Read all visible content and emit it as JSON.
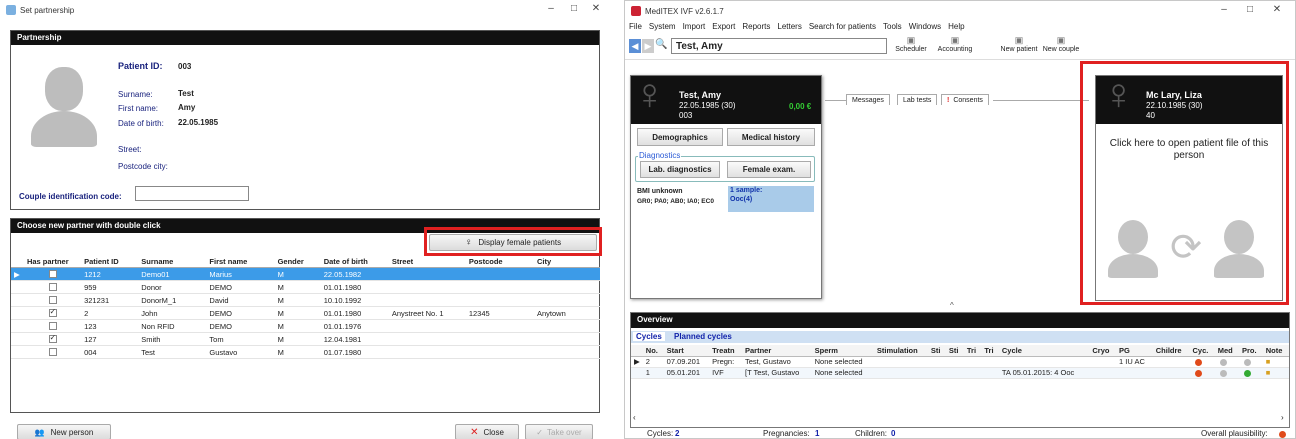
{
  "left": {
    "title": "Set partnership",
    "partnership_header": "Partnership",
    "patient_id_label": "Patient ID:",
    "patient_id": "003",
    "surname_label": "Surname:",
    "surname": "Test",
    "firstname_label": "First name:",
    "firstname": "Amy",
    "dob_label": "Date of birth:",
    "dob": "22.05.1985",
    "street_label": "Street:",
    "postcode_label": "Postcode city:",
    "couple_label": "Couple identification code:",
    "couple_value": "",
    "choose_header": "Choose new partner with double click",
    "display_female_button": "Display female patients",
    "columns": [
      "Has partner",
      "Patient ID",
      "Surname",
      "First name",
      "Gender",
      "Date of birth",
      "Street",
      "Postcode",
      "City"
    ],
    "rows": [
      {
        "has_partner": false,
        "id": "1212",
        "surname": "Demo01",
        "first": "Marius",
        "gender": "M",
        "dob": "22.05.1982",
        "street": "",
        "postcode": "",
        "city": "",
        "selected": true
      },
      {
        "has_partner": false,
        "id": "959",
        "surname": "Donor",
        "first": "DEMO",
        "gender": "M",
        "dob": "01.01.1980",
        "street": "",
        "postcode": "",
        "city": ""
      },
      {
        "has_partner": false,
        "id": "321231",
        "surname": "DonorM_1",
        "first": "David",
        "gender": "M",
        "dob": "10.10.1992",
        "street": "",
        "postcode": "",
        "city": ""
      },
      {
        "has_partner": true,
        "id": "2",
        "surname": "John",
        "first": "DEMO",
        "gender": "M",
        "dob": "01.01.1980",
        "street": "Anystreet No. 1",
        "postcode": "12345",
        "city": "Anytown"
      },
      {
        "has_partner": false,
        "id": "123",
        "surname": "Non RFID",
        "first": "DEMO",
        "gender": "M",
        "dob": "01.01.1976",
        "street": "",
        "postcode": "",
        "city": ""
      },
      {
        "has_partner": true,
        "id": "127",
        "surname": "Smith",
        "first": "Tom",
        "gender": "M",
        "dob": "12.04.1981",
        "street": "",
        "postcode": "",
        "city": ""
      },
      {
        "has_partner": false,
        "id": "004",
        "surname": "Test",
        "first": "Gustavo",
        "gender": "M",
        "dob": "01.07.1980",
        "street": "",
        "postcode": "",
        "city": ""
      }
    ],
    "new_person_button": "New person",
    "close_button": "Close",
    "take_over_button": "Take over"
  },
  "right": {
    "title": "MedITEX IVF v2.6.1.7",
    "menu": [
      "File",
      "System",
      "Import",
      "Export",
      "Reports",
      "Letters",
      "Search for patients",
      "Tools",
      "Windows",
      "Help"
    ],
    "patient_name": "Test, Amy",
    "toolbar": [
      "Scheduler",
      "Accounting",
      "New patient",
      "New couple"
    ],
    "card": {
      "name": "Test, Amy",
      "dob": "22.05.1985 (30)",
      "id": "003",
      "balance": "0,00 €"
    },
    "demographics": "Demographics",
    "medical_history": "Medical history",
    "diagnostics_label": "Diagnostics",
    "lab_diag": "Lab. diagnostics",
    "female_exam": "Female exam.",
    "bmi": "BMI unknown",
    "gr": "GR0; PA0; AB0; IA0; EC0",
    "sample": "1 sample:",
    "sample_detail": "Ooc(4)",
    "tabs": [
      "Messages",
      "Lab tests",
      "Consents"
    ],
    "partner": {
      "name": "Mc Lary, Liza",
      "dob": "22.10.1985 (30)",
      "id": "40",
      "open_text": "Click here to open patient file of this person"
    },
    "overview_header": "Overview",
    "cycle_tabs": [
      "Cycles",
      "Planned cycles"
    ],
    "cycle_columns": [
      "No.",
      "Start",
      "Treatn",
      "Partner",
      "Sperm",
      "Stimulation",
      "Sti",
      "Sti",
      "Tri",
      "Tri",
      "Cycle",
      "Cryo",
      "PG",
      "Childre",
      "Cyc.",
      "Med",
      "Pro.",
      "Note"
    ],
    "cycles": [
      {
        "no": "2",
        "start": "07.09.201",
        "treat": "Pregn:",
        "partner": "Test, Gustavo",
        "sperm": "None selected",
        "cycle": "",
        "pg": "1 IU AC"
      },
      {
        "no": "1",
        "start": "05.01.201",
        "treat": "IVF",
        "partner": "[T Test, Gustavo",
        "sperm": "None selected",
        "cycle": "TA 05.01.2015: 4 Ooc",
        "pg": ""
      }
    ],
    "footer_cycles_label": "Cycles:",
    "footer_cycles": "2",
    "footer_preg_label": "Pregnancies:",
    "footer_preg": "1",
    "footer_children_label": "Children:",
    "footer_children": "0",
    "footer_plaus": "Overall plausibility:"
  },
  "colors": {
    "accent": "#3c9be8",
    "highlight": "#e02020",
    "dark": "#111111"
  }
}
